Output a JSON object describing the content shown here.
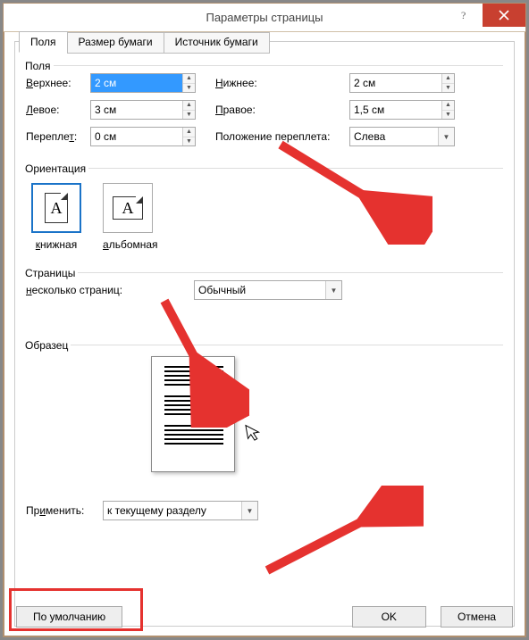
{
  "title": "Параметры страницы",
  "tabs": {
    "fields": "Поля",
    "paper": "Размер бумаги",
    "source": "Источник бумаги"
  },
  "groups": {
    "fields": "Поля",
    "orientation": "Ориентация",
    "pages": "Страницы",
    "sample": "Образец"
  },
  "labels": {
    "top": "Верхнее:",
    "top_u": "В",
    "bottom": "Нижнее:",
    "bottom_u": "Н",
    "left": "Левое:",
    "left_u": "Л",
    "right": "Правое:",
    "right_u": "П",
    "gutter": "Переплет:",
    "gutter_u": "т",
    "gutter_pos": "Положение переплета:",
    "multipage": "несколько страниц:",
    "multipage_u": "н",
    "apply": "Применить:",
    "apply_u": "и"
  },
  "values": {
    "top": "2 см",
    "bottom": "2 см",
    "left": "3 см",
    "right": "1,5 см",
    "gutter": "0 см",
    "gutter_pos": "Слева",
    "multipage": "Обычный",
    "apply": "к текущему разделу"
  },
  "orientation": {
    "portrait": "книжная",
    "portrait_u": "к",
    "landscape": "альбомная",
    "landscape_u": "а",
    "glyph": "A"
  },
  "buttons": {
    "default": "По умолчанию",
    "ok": "OK",
    "cancel": "Отмена"
  }
}
